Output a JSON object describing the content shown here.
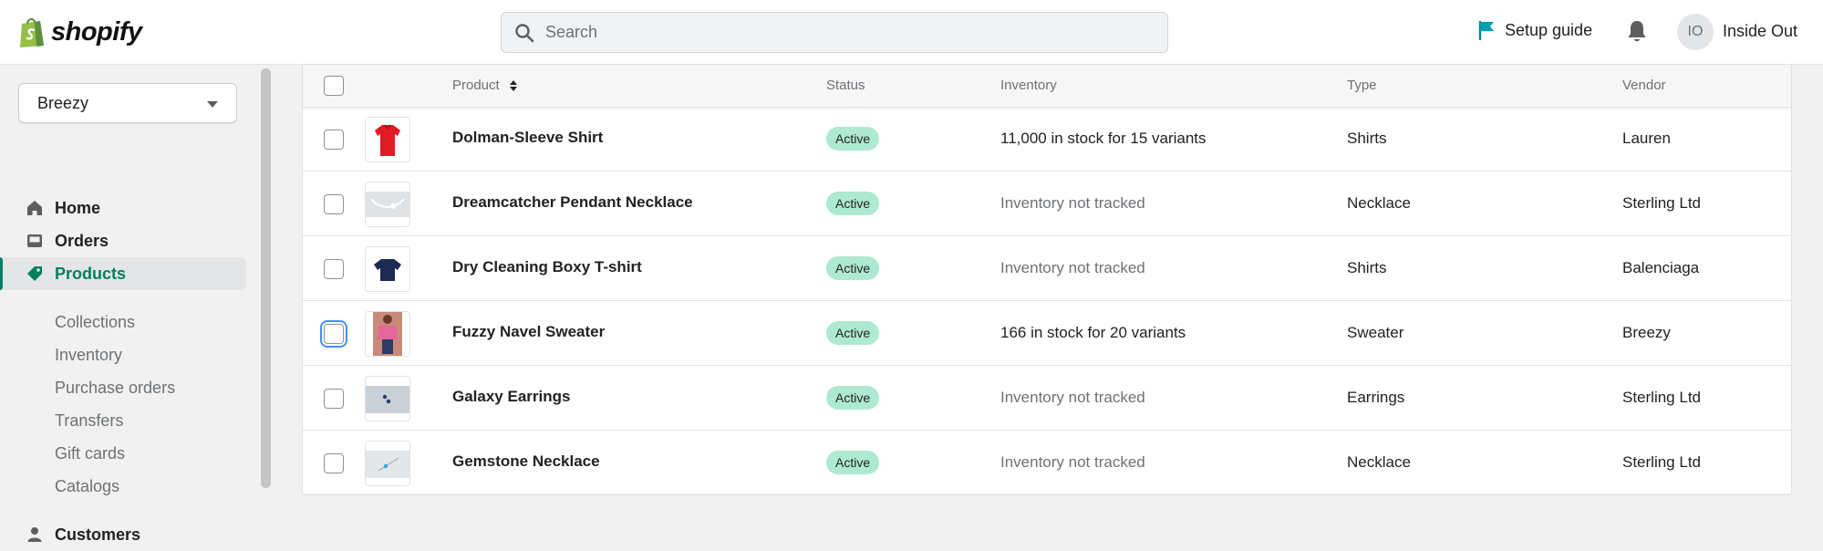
{
  "topbar": {
    "brand": "shopify",
    "search_placeholder": "Search",
    "setup_guide_label": "Setup guide",
    "avatar_initials": "IO",
    "store_name": "Inside Out"
  },
  "sidebar": {
    "store_selector": "Breezy",
    "items": [
      {
        "label": "Home",
        "icon": "home-icon"
      },
      {
        "label": "Orders",
        "icon": "orders-icon"
      },
      {
        "label": "Products",
        "icon": "tag-icon",
        "active": true
      },
      {
        "label": "Customers",
        "icon": "person-icon"
      }
    ],
    "product_subitems": [
      "Collections",
      "Inventory",
      "Purchase orders",
      "Transfers",
      "Gift cards",
      "Catalogs"
    ]
  },
  "table": {
    "columns": {
      "product": "Product",
      "status": "Status",
      "inventory": "Inventory",
      "type": "Type",
      "vendor": "Vendor"
    },
    "rows": [
      {
        "name": "Dolman-Sleeve Shirt",
        "status": "Active",
        "inventory": "11,000 in stock for 15 variants",
        "tracked": true,
        "type": "Shirts",
        "vendor": "Lauren"
      },
      {
        "name": "Dreamcatcher Pendant Necklace",
        "status": "Active",
        "inventory": "Inventory not tracked",
        "tracked": false,
        "type": "Necklace",
        "vendor": "Sterling Ltd"
      },
      {
        "name": "Dry Cleaning Boxy T-shirt",
        "status": "Active",
        "inventory": "Inventory not tracked",
        "tracked": false,
        "type": "Shirts",
        "vendor": "Balenciaga"
      },
      {
        "name": "Fuzzy Navel Sweater",
        "status": "Active",
        "inventory": "166 in stock for 20 variants",
        "tracked": true,
        "type": "Sweater",
        "vendor": "Breezy"
      },
      {
        "name": "Galaxy Earrings",
        "status": "Active",
        "inventory": "Inventory not tracked",
        "tracked": false,
        "type": "Earrings",
        "vendor": "Sterling Ltd"
      },
      {
        "name": "Gemstone Necklace",
        "status": "Active",
        "inventory": "Inventory not tracked",
        "tracked": false,
        "type": "Necklace",
        "vendor": "Sterling Ltd"
      }
    ]
  },
  "colors": {
    "accent": "#008060",
    "badge_active": "#aee9d1",
    "focus": "#458fff"
  }
}
